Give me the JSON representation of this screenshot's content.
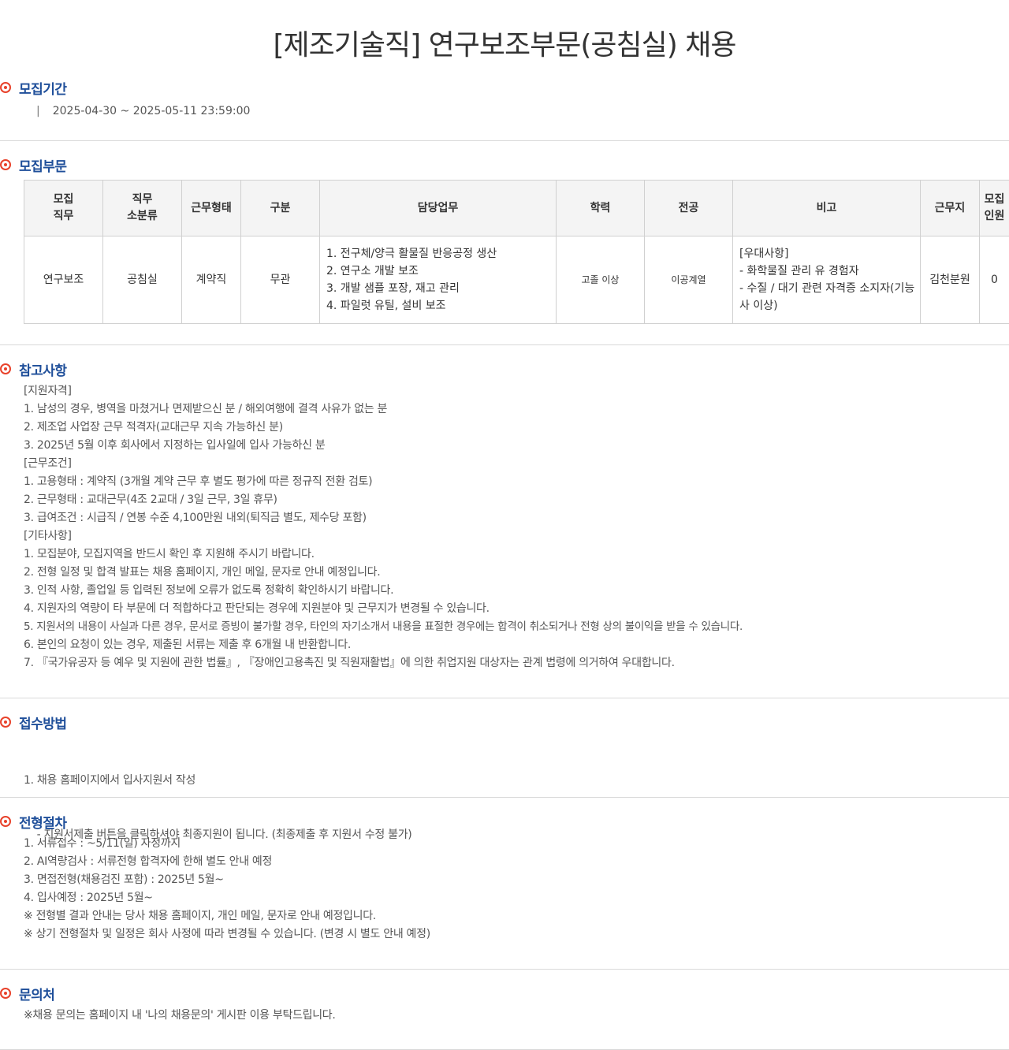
{
  "title": "[제조기술직] 연구보조부문(공침실) 채용",
  "sections": {
    "period": {
      "title": "모집기간",
      "value": "2025-04-30 ~ 2025-05-11 23:59:00"
    },
    "division": {
      "title": "모집부문",
      "table": {
        "headers": [
          [
            "모집",
            "직무"
          ],
          [
            "직무",
            "소분류"
          ],
          [
            "근무형태"
          ],
          [
            "구분"
          ],
          [
            "담당업무"
          ],
          [
            "학력"
          ],
          [
            "전공"
          ],
          [
            "비고"
          ],
          [
            "근무지"
          ],
          [
            "모집",
            "인원"
          ]
        ],
        "row": {
          "job": "연구보조",
          "subcategory": "공침실",
          "employment": "계약직",
          "category": "무관",
          "duties": [
            "1. 전구체/양극 활물질 반응공정 생산",
            "2. 연구소 개발 보조",
            "3. 개발 샘플 포장, 재고 관리",
            "4. 파일럿 유틸, 설비 보조"
          ],
          "education": "고졸 이상",
          "major": "이공계열",
          "remarks": [
            "[우대사항]",
            "- 화학물질 관리 유 경험자",
            "- 수질 / 대기 관련 자격증 소지자(기능",
            "사 이상)"
          ],
          "location": "김천분원",
          "count": "0"
        }
      }
    },
    "notes": {
      "title": "참고사항",
      "lines": [
        "[지원자격]",
        "1. 남성의 경우, 병역을 마쳤거나 면제받으신 분 / 해외여행에 결격 사유가 없는 분",
        "2. 제조업 사업장 근무 적격자(교대근무 지속 가능하신 분)",
        "3. 2025년 5월 이후 회사에서 지정하는 입사일에 입사 가능하신 분",
        "[근무조건]",
        "1. 고용형태 : 계약직 (3개월 계약 근무 후 별도 평가에 따른 정규직 전환 검토)",
        "2. 근무형태 : 교대근무(4조 2교대 / 3일 근무, 3일 휴무)",
        "3. 급여조건 : 시급직 / 연봉 수준 4,100만원 내외(퇴직금 별도, 제수당 포함)",
        "[기타사항]",
        "1. 모집분야, 모집지역을 반드시 확인 후 지원해 주시기 바랍니다.",
        "2. 전형 일정 및 합격 발표는 채용 홈페이지, 개인 메일, 문자로 안내 예정입니다.",
        "3. 인적 사항, 졸업일 등 입력된 정보에 오류가 없도록 정확히 확인하시기 바랍니다.",
        "4. 지원자의 역량이 타 부문에 더 적합하다고 판단되는 경우에 지원분야 및 근무지가 변경될 수 있습니다.",
        "5. 지원서의 내용이 사실과 다른 경우, 문서로 증빙이 불가할 경우, 타인의 자기소개서 내용을 표절한 경우에는 합격이 취소되거나 전형 상의 불이익을 받을 수 있습니다.",
        "6. 본인의 요청이 있는 경우, 제출된 서류는 제출 후 6개월 내 반환합니다.",
        "7. 『국가유공자 등 예우 및 지원에 관한 법률』, 『장애인고용촉진 및 직원재활법』에 의한 취업지원 대상자는 관계 법령에 의거하여 우대합니다."
      ]
    },
    "apply": {
      "title": "접수방법",
      "lines": [
        "1. 채용 홈페이지에서 입사지원서 작성",
        "    - 지원서제출 버튼을 클릭하셔야 최종지원이 됩니다. (최종제출 후 지원서 수정 불가)"
      ]
    },
    "process": {
      "title": "전형절차",
      "lines": [
        "1. 서류접수 : ~5/11(일) 자정까지",
        "2. AI역량검사 : 서류전형 합격자에 한해 별도 안내 예정",
        "3. 면접전형(채용검진 포함) : 2025년 5월~",
        "4. 입사예정 : 2025년 5월~",
        "※ 전형별 결과 안내는 당사 채용 홈페이지, 개인 메일, 문자로 안내 예정입니다.",
        "※ 상기 전형절차 및 일정은 회사 사정에 따라 변경될 수 있습니다. (변경 시 별도 안내 예정)"
      ]
    },
    "contact": {
      "title": "문의처",
      "lines": [
        "※채용 문의는 홈페이지 내 '나의 채용문의' 게시판 이용 부탁드립니다."
      ]
    }
  },
  "colors": {
    "accent": "#e8412a",
    "heading": "#1f4f9a"
  },
  "icons": {
    "section_bullet": "target-bullet-icon"
  }
}
